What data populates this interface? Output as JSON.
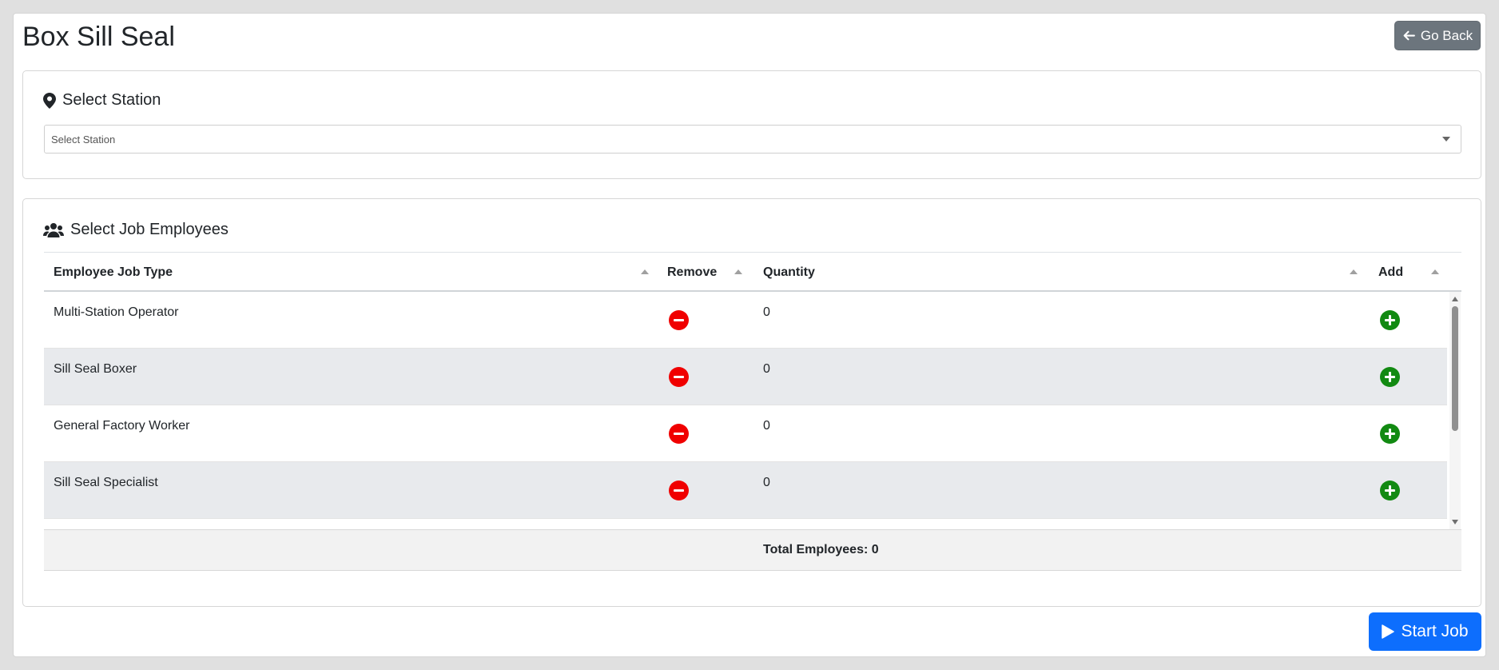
{
  "page": {
    "title": "Box Sill Seal"
  },
  "header": {
    "go_back_label": "Go Back"
  },
  "station_card": {
    "heading": "Select Station",
    "select": {
      "placeholder": "Select Station",
      "selected": "Select Station"
    }
  },
  "employees_card": {
    "heading": "Select Job Employees",
    "columns": {
      "job_type": "Employee Job Type",
      "remove": "Remove",
      "quantity": "Quantity",
      "add": "Add"
    },
    "rows": [
      {
        "job_type": "Multi-Station Operator",
        "quantity": "0"
      },
      {
        "job_type": "Sill Seal Boxer",
        "quantity": "0"
      },
      {
        "job_type": "General Factory Worker",
        "quantity": "0"
      },
      {
        "job_type": "Sill Seal Specialist",
        "quantity": "0"
      }
    ],
    "total_label": "Total Employees: 0"
  },
  "footer": {
    "start_job_label": "Start Job"
  },
  "colors": {
    "remove_button": "#f00000",
    "add_button": "#128a12",
    "start_button": "#0d6efd",
    "go_back_button": "#6c757d",
    "alt_row": "#e8eaed"
  },
  "icons": {
    "go_back": "arrow-left-icon",
    "station": "map-pin-icon",
    "employees": "users-icon",
    "remove": "minus-circle-icon",
    "add": "plus-circle-icon",
    "start": "play-icon"
  }
}
